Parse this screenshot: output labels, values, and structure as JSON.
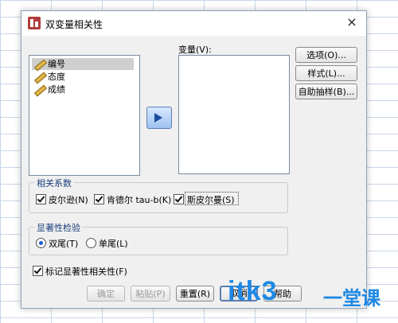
{
  "window": {
    "title": "双变量相关性",
    "close_glyph": "×"
  },
  "variables_list": {
    "items": [
      {
        "label": "编号",
        "selected": true
      },
      {
        "label": "态度",
        "selected": false
      },
      {
        "label": "成绩",
        "selected": false
      }
    ]
  },
  "target": {
    "label": "变量(V):"
  },
  "side_buttons": {
    "options": "选项(O)...",
    "style": "样式(L)...",
    "bootstrap": "自助抽样(B)..."
  },
  "correlation": {
    "legend": "相关系数",
    "pearson": {
      "label": "皮尔逊(N)",
      "checked": true
    },
    "kendall": {
      "label": "肯德尔 tau-b(K)",
      "checked": true
    },
    "spearman": {
      "label": "斯皮尔曼(S)",
      "checked": true
    }
  },
  "significance": {
    "legend": "显著性检验",
    "two_tailed": {
      "label": "双尾(T)",
      "checked": true
    },
    "one_tailed": {
      "label": "单尾(L)",
      "checked": false
    }
  },
  "flag": {
    "label": "标记显著性相关性(F)",
    "checked": true
  },
  "bottom_buttons": {
    "ok": "确定",
    "paste": "粘贴(P)",
    "reset": "重置(R)",
    "cancel": "取消",
    "help": "帮助"
  },
  "watermark": {
    "text": "itk3",
    "cn": "一堂课"
  },
  "colors": {
    "accent": "#1e88e5",
    "legend": "#1a3e7a",
    "grid": "#c8d6e8"
  }
}
